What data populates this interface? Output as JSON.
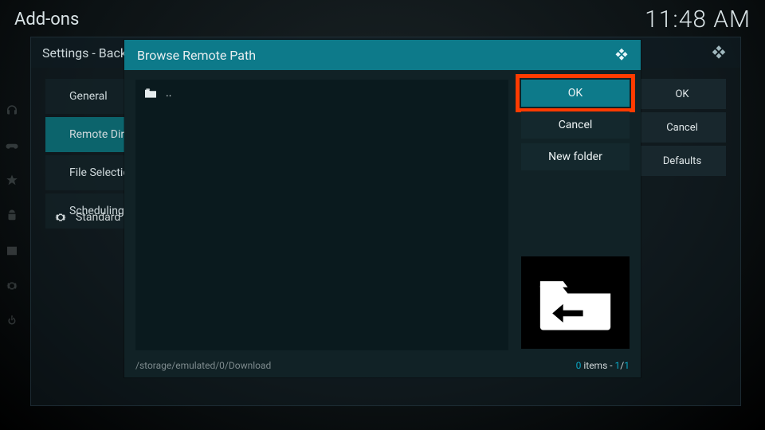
{
  "top": {
    "title": "Add-ons",
    "time": "11:48 AM"
  },
  "card": {
    "title": "Settings - Backup",
    "tabs": [
      "General",
      "Remote Dir",
      "File Selection",
      "Scheduling"
    ],
    "selected_index": 1,
    "level": "Standard",
    "buttons": {
      "ok": "OK",
      "cancel": "Cancel",
      "defaults": "Defaults"
    }
  },
  "dialog": {
    "title": "Browse Remote Path",
    "list": [
      {
        "icon": "folder-up",
        "label": ".."
      }
    ],
    "actions": {
      "ok": "OK",
      "cancel": "Cancel",
      "newfolder": "New folder"
    },
    "path": "/storage/emulated/0/Download",
    "items_count": 0,
    "page_cur": 1,
    "page_total": 1
  }
}
